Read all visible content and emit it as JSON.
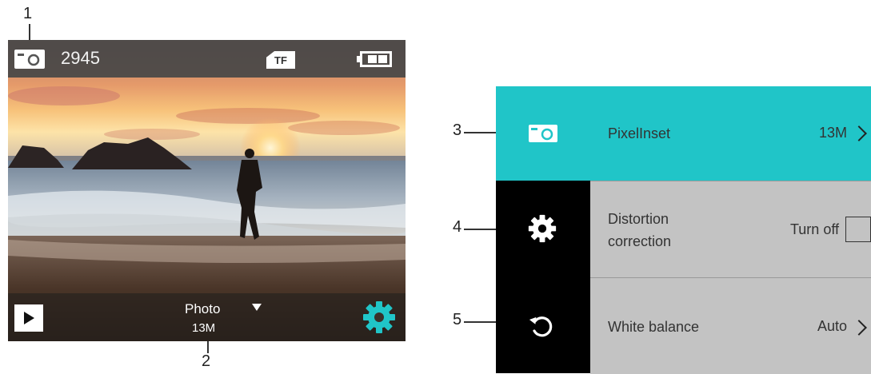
{
  "colors": {
    "accent": "#20c5c8",
    "menu_bg": "#c3c3c3",
    "icon_column": "#000000"
  },
  "callouts": {
    "c1": "1",
    "c2": "2",
    "c3": "3",
    "c4": "4",
    "c5": "5"
  },
  "camera": {
    "mode_icon": "camera-icon",
    "shot_count": "2945",
    "storage_badge": "TF",
    "battery_icon": "battery-icon",
    "play_icon": "play-icon",
    "mode_label": "Photo",
    "mode_dropdown_icon": "caret-down-icon",
    "resolution": "13M",
    "settings_icon": "gear-icon"
  },
  "menu": {
    "rows": [
      {
        "icon": "camera-icon",
        "label": "PixelInset",
        "value": "13M",
        "control": "chevron-right-icon"
      },
      {
        "icon": "gear-icon",
        "label_line1": "Distortion",
        "label_line2": "correction",
        "value": "Turn off",
        "control": "checkbox"
      },
      {
        "icon": "reset-icon",
        "label": "White balance",
        "value": "Auto",
        "control": "chevron-right-icon"
      }
    ]
  }
}
